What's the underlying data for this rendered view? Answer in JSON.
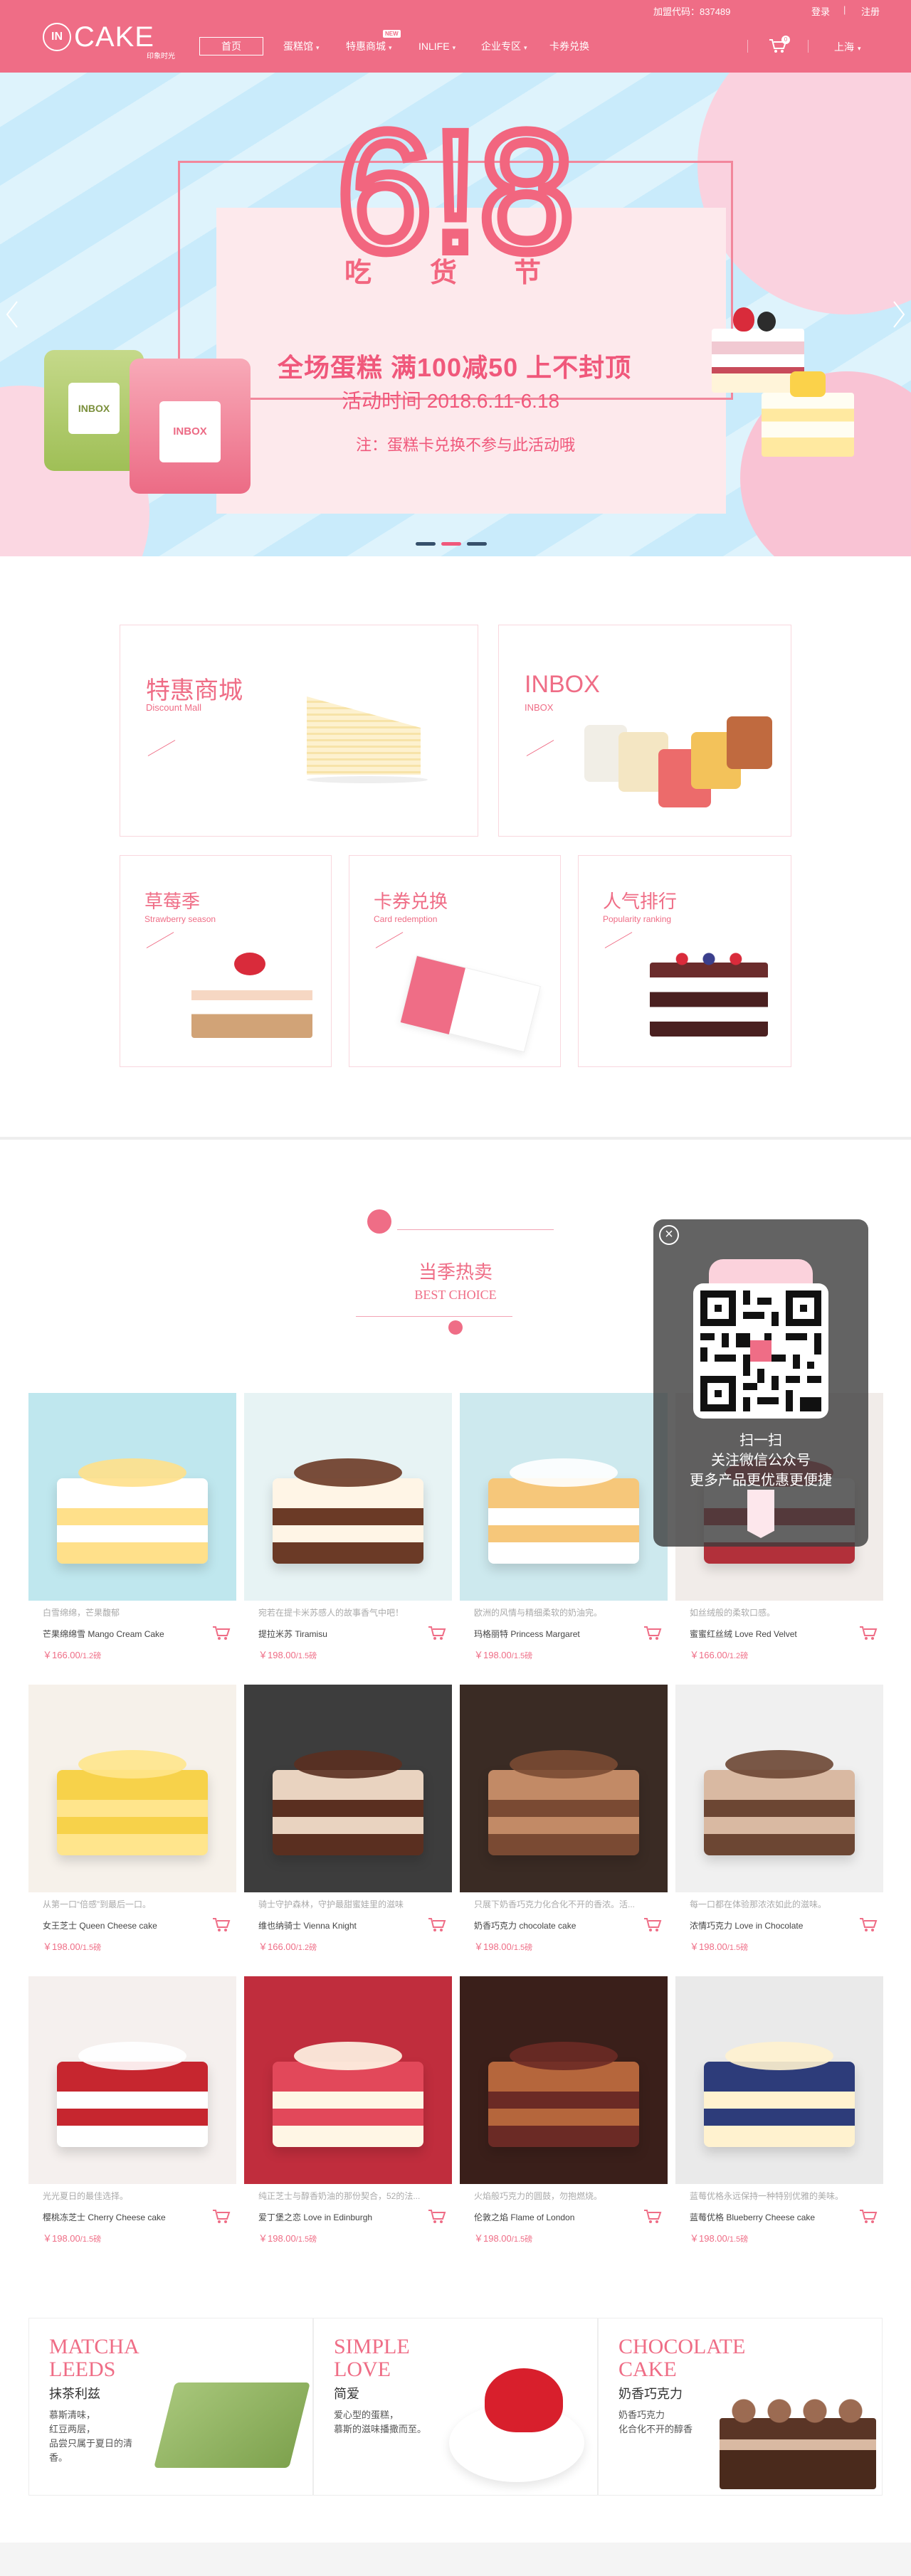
{
  "topbar": {
    "code": "加盟代码：837489",
    "login": "登录",
    "separator": "|",
    "register": "注册"
  },
  "header": {
    "logo_in": "IN",
    "logo_word": "CAKE",
    "logo_tag": "印象时光",
    "nav": [
      {
        "label": "首页"
      },
      {
        "label": "蛋糕馆"
      },
      {
        "label": "特惠商城",
        "badge": "NEW"
      },
      {
        "label": "INLIFE"
      },
      {
        "label": "企业专区"
      },
      {
        "label": "卡券兑换"
      }
    ],
    "cart_count": "0",
    "city": "上海"
  },
  "banner": {
    "big_text": "6!8",
    "eat": [
      "吃",
      "货",
      "节"
    ],
    "line1": "全场蛋糕  满100减50  上不封顶",
    "line2": "活动时间  2018.6.11-6.18",
    "note": "注：蛋糕卡兑换不参与此活动哦",
    "tin_label": "INBOX",
    "slides": 3,
    "active_slide": 2
  },
  "categories": [
    {
      "title": "特惠商城",
      "subtitle": "Discount Mall"
    },
    {
      "title": "INBOX",
      "subtitle": "INBOX"
    },
    {
      "title": "草莓季",
      "subtitle": "Strawberry season"
    },
    {
      "title": "卡券兑换",
      "subtitle": "Card redemption"
    },
    {
      "title": "人气排行",
      "subtitle": "Popularity ranking"
    }
  ],
  "hot": {
    "title": "当季热卖",
    "subtitle": "BEST CHOICE"
  },
  "qr": {
    "line1": "扫一扫",
    "line2": "关注微信公众号",
    "line3": "更多产品更优惠更便捷"
  },
  "products": [
    {
      "desc": "白雪绵绵，芒果馥郁",
      "name": "芒果绵绵雪 Mango Cream Cake",
      "price": "￥166.00",
      "unit": "/1.2磅"
    },
    {
      "desc": "宛若在提卡米苏感人的故事香气中吧！",
      "name": "提拉米苏 Tiramisu",
      "price": "￥198.00",
      "unit": "/1.5磅"
    },
    {
      "desc": "欧洲的风情与精细柔软的奶油完。",
      "name": "玛格丽特 Princess Margaret",
      "price": "￥198.00",
      "unit": "/1.5磅"
    },
    {
      "desc": "如丝绒般的柔软口感。",
      "name": "蜜蜜红丝绒 Love Red Velvet",
      "price": "￥166.00",
      "unit": "/1.2磅"
    },
    {
      "desc": "从第一口“倍感”到最后一口。",
      "name": "女王芝士 Queen Cheese cake",
      "price": "￥198.00",
      "unit": "/1.5磅"
    },
    {
      "desc": "骑士守护森林，守护最甜蜜娃里的滋味",
      "name": "维也纳骑士 Vienna Knight",
      "price": "￥166.00",
      "unit": "/1.2磅"
    },
    {
      "desc": "只展下奶香巧克力化合化不开的香浓。活...",
      "name": "奶香巧克力 chocolate cake",
      "price": "￥198.00",
      "unit": "/1.5磅"
    },
    {
      "desc": "每一口都在体验那浓浓如此的滋味。",
      "name": "浓情巧克力 Love in Chocolate",
      "price": "￥198.00",
      "unit": "/1.5磅"
    },
    {
      "desc": "光光夏日的最佳选择。",
      "name": "樱桃冻芝士 Cherry Cheese cake",
      "price": "￥198.00",
      "unit": "/1.5磅"
    },
    {
      "desc": "纯正芝士与醇香奶油的那份契合，52的法...",
      "name": "爱丁堡之恋 Love in Edinburgh",
      "price": "￥198.00",
      "unit": "/1.5磅"
    },
    {
      "desc": "火焰般巧克力的圆鼓，勿抱燃烧。",
      "name": "伦敦之焰 Flame of London",
      "price": "￥198.00",
      "unit": "/1.5磅"
    },
    {
      "desc": "蓝莓优格永远保持一种特别优雅的美味。",
      "name": "蓝莓优格 Blueberry Cheese cake",
      "price": "￥198.00",
      "unit": "/1.5磅"
    }
  ],
  "promos": [
    {
      "en1": "MATCHA",
      "en2": "LEEDS",
      "zh": "抹茶利兹",
      "desc": "慕斯清味，\n红豆两层，\n品尝只属于夏日的清香。"
    },
    {
      "en1": "SIMPLE",
      "en2": "LOVE",
      "zh": "简爱",
      "desc": "爱心型的蛋糕，\n慕斯的滋味播撒而至。"
    },
    {
      "en1": "CHOCOLATE",
      "en2": "CAKE",
      "zh": "奶香巧克力",
      "desc": "奶香巧克力\n化合化不开的醇香"
    }
  ],
  "colors": {
    "brand": "#ef6d86",
    "banner_stripe_a": "#c9ebfb",
    "banner_stripe_b": "#def3fc"
  }
}
